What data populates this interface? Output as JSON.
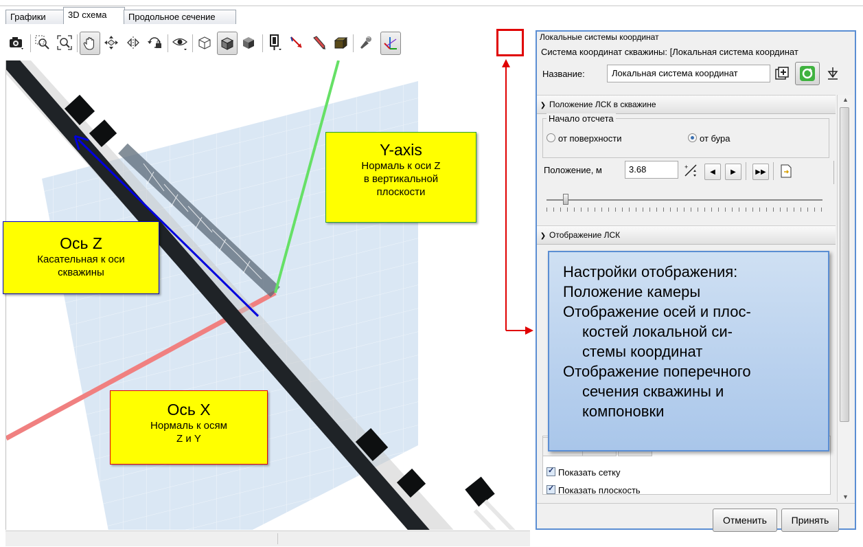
{
  "tabs": [
    "Графики",
    "3D схема",
    "Продольное сечение"
  ],
  "toolbar": {
    "icons": [
      "camera-icon",
      "zoom-region-icon",
      "zoom-fit-icon",
      "pan-hand-icon",
      "move-axes-icon",
      "rotate-icon",
      "rotate-lock-icon",
      "view-eye-icon",
      "wireframe-cube-icon",
      "shaded-cube-icon",
      "solid-cube-icon",
      "well-tool-icon",
      "axis-direction-icon",
      "pencil-icon",
      "box-icon",
      "light-icon",
      "local-coordinate-system-icon"
    ],
    "pressed": [
      "pan-hand-icon",
      "shaded-cube-icon",
      "local-coordinate-system-icon"
    ]
  },
  "callouts": {
    "y_axis": {
      "title": "Y-axis",
      "text": [
        "Нормаль к оси Z",
        "в вертикальной",
        "плоскости"
      ]
    },
    "z_axis": {
      "title": "Ось Z",
      "text": [
        "Касательная к оси",
        "скважины"
      ]
    },
    "x_axis": {
      "title": "Ось X",
      "text": [
        "Нормаль к осям",
        "Z и Y"
      ]
    }
  },
  "panel": {
    "window_title": "Локальные системы координат",
    "system_label": "Система координат скважины: [Локальная система координат",
    "name_label": "Название:",
    "name_value": "Локальная система координат",
    "section1": {
      "title": "Положение ЛСК в скважине",
      "origin_group": "Начало отсчета",
      "radio_surface": "от поверхности",
      "radio_bit": "от бура",
      "selected": "от бура",
      "position_label": "Положение, м",
      "position_value": "3.68",
      "slider_fraction": 0.07
    },
    "section2": {
      "title": "Отображение ЛСК"
    },
    "checkboxes": [
      {
        "label": "Показать сетку",
        "checked": true
      },
      {
        "label": "Показать плоскость",
        "checked": true
      }
    ],
    "cancel": "Отменить",
    "accept": "Принять"
  },
  "info_box": {
    "lines": [
      "Настройки отображения:",
      "Положение камеры",
      "Отображение осей и плос-",
      "костей локальной си-",
      "стемы координат",
      "Отображение поперечного",
      "сечения скважины и",
      "компоновки"
    ]
  },
  "colors": {
    "highlight_red": "#e00000",
    "panel_border": "#5b8ed3",
    "callout_yellow": "#ffff00",
    "x_axis": "#f08080",
    "y_axis": "#66e066",
    "z_arrow": "#0000dd"
  }
}
